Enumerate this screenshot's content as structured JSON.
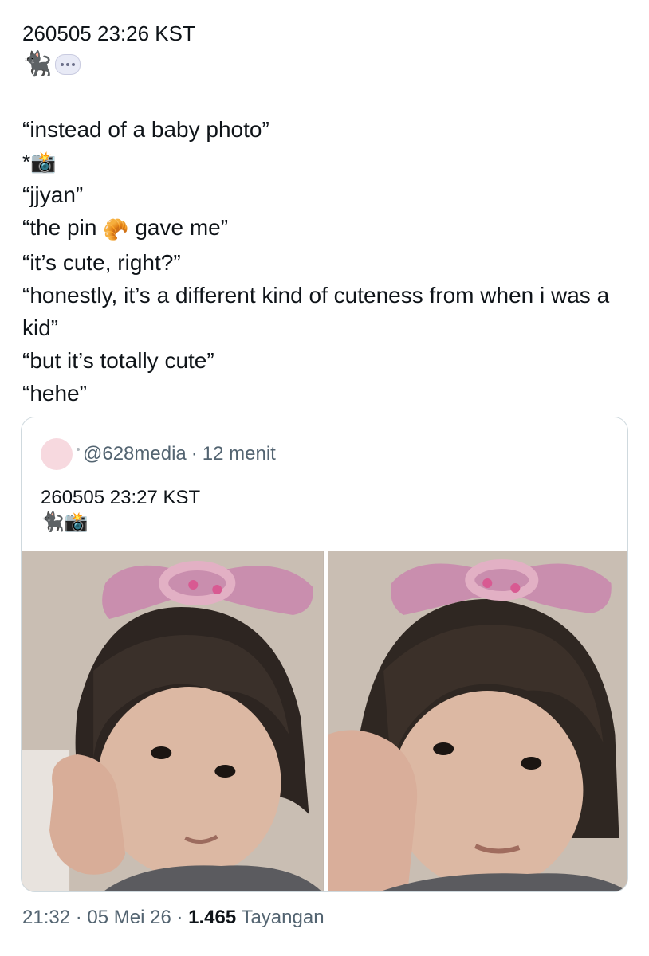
{
  "tweet": {
    "timestamp_text": "260505 23:26 KST",
    "emoji_icons": [
      "black-cat-icon",
      "thought-bubble-icon"
    ],
    "cat_glyph": "🐈‍⬛",
    "lines": [
      "“instead of a baby photo”",
      "*📸",
      "“jjyan”",
      "“the pin",
      "gave me”",
      "“it’s cute, right?”",
      "“honestly, it’s a different kind of cuteness from when i was a kid”",
      "“but it’s totally cute”",
      "“hehe”"
    ],
    "croissant_glyph": "🥐"
  },
  "quote": {
    "handle": "@628media",
    "separator": "·",
    "time_ago": "12 menit",
    "text": "260505 23:27 KST",
    "emoji_text": "🐈‍⬛📸"
  },
  "footer": {
    "time": "21:32",
    "date": "05 Mei 26",
    "views_count": "1.465",
    "views_label": "Tayangan",
    "separator": "·"
  },
  "colors": {
    "text": "#0f1419",
    "muted": "#536471",
    "border": "#cfd9de",
    "avatar": "#f7d9df"
  }
}
